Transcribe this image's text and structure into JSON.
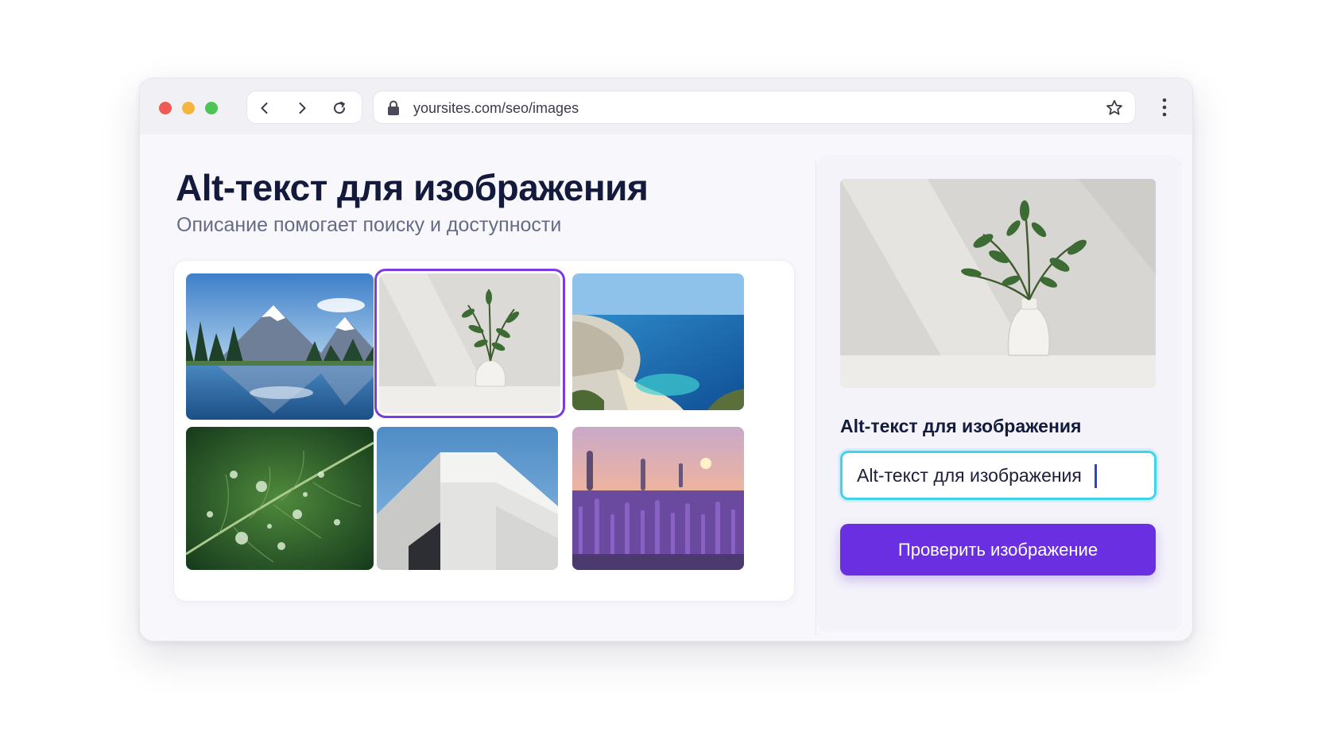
{
  "browser": {
    "url": "yoursites.com/seo/images"
  },
  "page": {
    "title": "Alt-текст для изображения",
    "subtitle": "Описание помогает поиску и доступности"
  },
  "gallery": {
    "images": [
      {
        "subject": "mountain-lake",
        "selected": false
      },
      {
        "subject": "plant-vase",
        "selected": true
      },
      {
        "subject": "coast-beach",
        "selected": false
      },
      {
        "subject": "leaf-droplets",
        "selected": false
      },
      {
        "subject": "white-building",
        "selected": false
      },
      {
        "subject": "lavender-sunset",
        "selected": false
      }
    ]
  },
  "panel": {
    "field_label": "Alt-текст для изображения",
    "input_value": "Alt-текст для изображения",
    "button_label": "Проверить изображение"
  },
  "colors": {
    "accent": "#6a2fe0",
    "input_focus": "#3fd4ec",
    "title": "#141a3c"
  }
}
